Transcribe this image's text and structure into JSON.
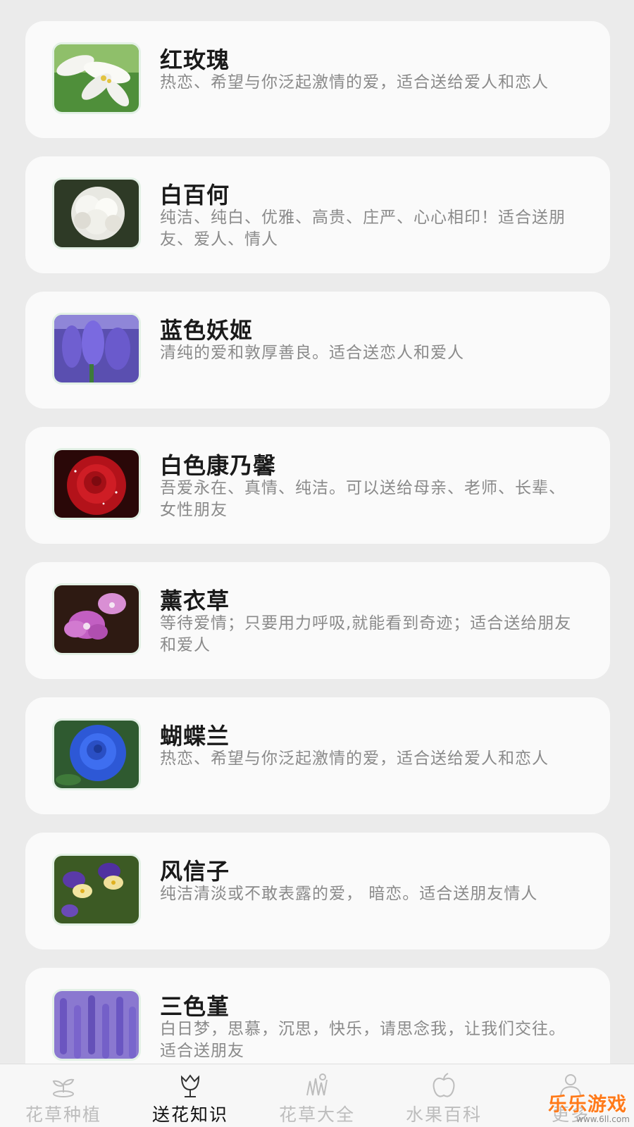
{
  "flowers": [
    {
      "name": "红玫瑰",
      "desc": "热恋、希望与你泛起激情的爱，适合送给爱人和恋人",
      "image": "white-lily-photo"
    },
    {
      "name": "白百何",
      "desc": "纯洁、纯白、优雅、高贵、庄严、心心相印！适合送朋友、爱人、情人",
      "image": "white-carnation-photo"
    },
    {
      "name": "蓝色妖姬",
      "desc": "清纯的爱和敦厚善良。适合送恋人和爱人",
      "image": "purple-hyacinth-photo"
    },
    {
      "name": "白色康乃馨",
      "desc": "吾爱永在、真情、纯洁。可以送给母亲、老师、长辈、女性朋友",
      "image": "red-rose-photo"
    },
    {
      "name": "薰衣草",
      "desc": "等待爱情；只要用力呼吸,就能看到奇迹；适合送给朋友和爱人",
      "image": "pink-orchid-photo"
    },
    {
      "name": "蝴蝶兰",
      "desc": "热恋、希望与你泛起激情的爱，适合送给爱人和恋人",
      "image": "blue-rose-photo"
    },
    {
      "name": "风信子",
      "desc": "纯洁清淡或不敢表露的爱， 暗恋。适合送朋友情人",
      "image": "pansy-photo"
    },
    {
      "name": "三色堇",
      "desc": "白日梦，思慕，沉思，快乐，请思念我，让我们交往。适合送朋友",
      "image": "lavender-photo"
    }
  ],
  "tabbar": {
    "tabs": [
      {
        "label": "花草种植",
        "icon": "sprout-icon",
        "active": false
      },
      {
        "label": "送花知识",
        "icon": "tulip-icon",
        "active": true
      },
      {
        "label": "花草大全",
        "icon": "grass-icon",
        "active": false
      },
      {
        "label": "水果百科",
        "icon": "apple-icon",
        "active": false
      },
      {
        "label": "更多",
        "icon": "person-icon",
        "active": false
      }
    ]
  },
  "watermark": {
    "text": "乐乐游戏",
    "url": "www.6ll.com"
  },
  "colors": {
    "background": "#ebebeb",
    "card": "#fafafa",
    "active_tab": "#111111",
    "inactive_tab": "#bdbdbd",
    "thumb_border": "#e3f1e6"
  }
}
